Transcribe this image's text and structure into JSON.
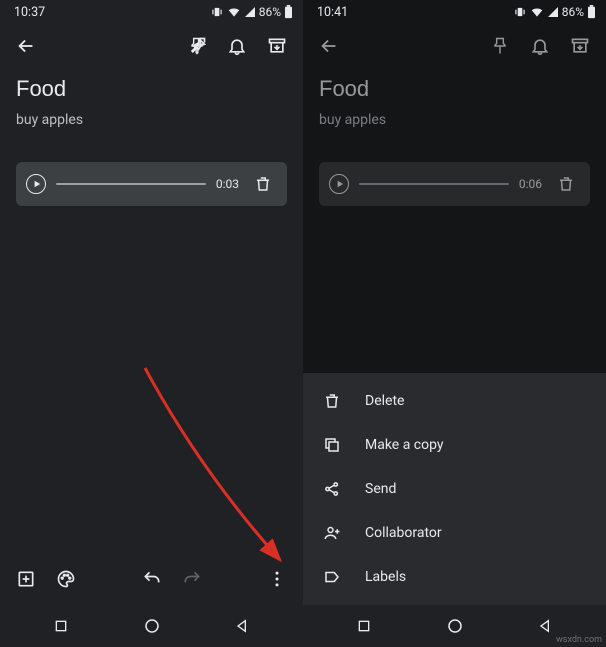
{
  "left": {
    "status": {
      "time": "10:37",
      "battery": "86%"
    },
    "title": "Food",
    "body": "buy apples",
    "audio": {
      "duration": "0:03"
    }
  },
  "right": {
    "status": {
      "time": "10:41",
      "battery": "86%"
    },
    "title": "Food",
    "body": "buy apples",
    "audio": {
      "duration": "0:06"
    },
    "sheet": {
      "delete": "Delete",
      "copy": "Make a copy",
      "send": "Send",
      "collab": "Collaborator",
      "labels": "Labels"
    }
  },
  "watermark": "wsxdn.com"
}
